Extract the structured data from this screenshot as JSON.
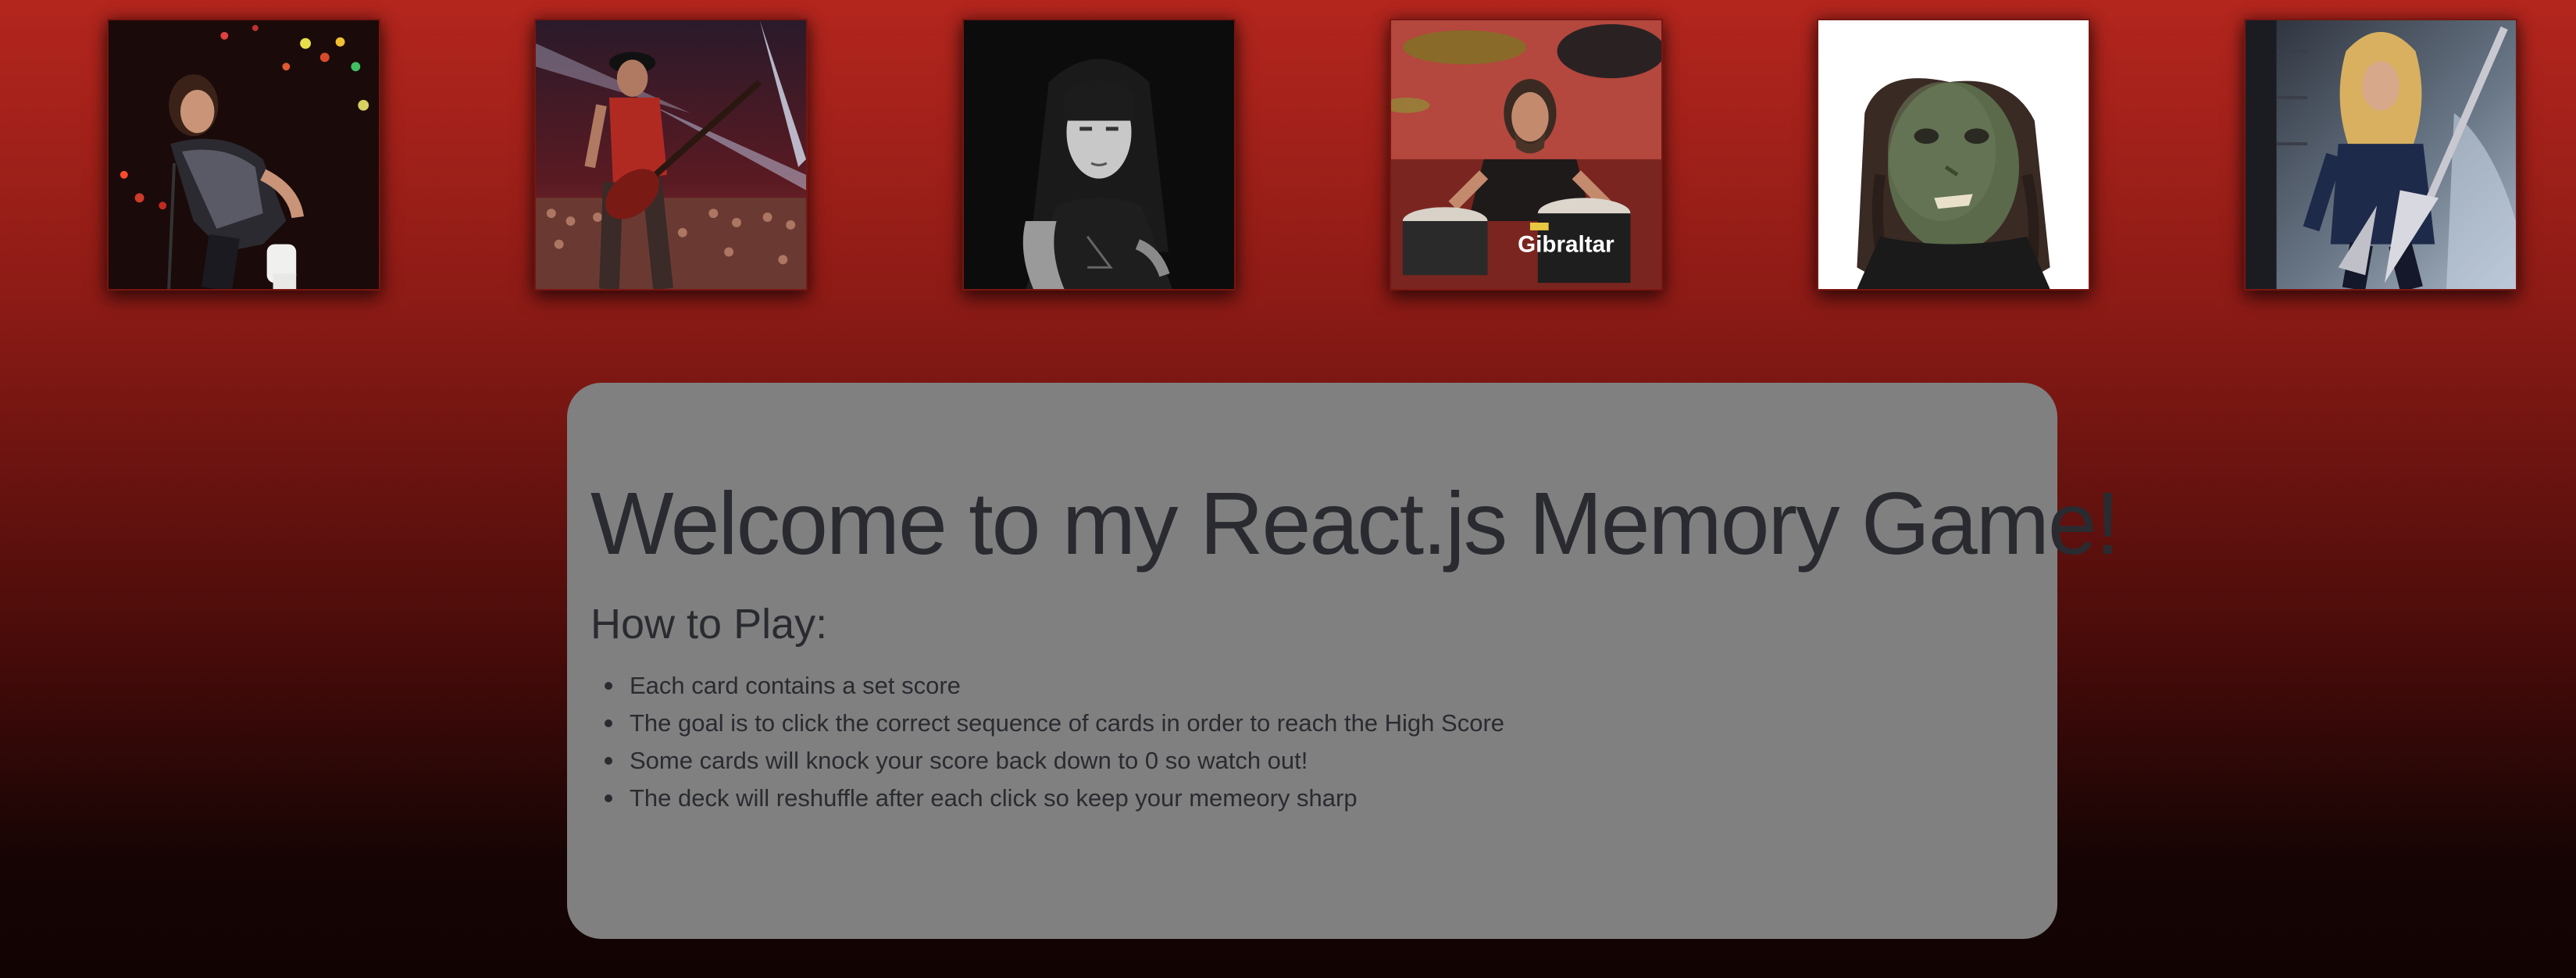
{
  "cards": [
    {
      "name": "card-singer-stage",
      "alt": "Metal singer performing on stage"
    },
    {
      "name": "card-bassist-stage",
      "alt": "Bassist playing to a large crowd"
    },
    {
      "name": "card-guitarist-portrait",
      "alt": "Black and white portrait of a guitarist"
    },
    {
      "name": "card-drummer",
      "alt": "Drummer behind a drum kit",
      "kit_text": "Gibraltar"
    },
    {
      "name": "card-masked-musician",
      "alt": "Musician wearing a mask"
    },
    {
      "name": "card-guitarist-flying-v",
      "alt": "Guitarist with a V-shaped guitar"
    }
  ],
  "welcome": {
    "title": "Welcome to my React.js Memory Game!",
    "subtitle": "How to Play:",
    "rules": [
      "Each card contains a set score",
      "The goal is to click the correct sequence of cards in order to reach the High Score",
      "Some cards will knock your score back down to 0 so watch out!",
      "The deck will reshuffle after each click so keep your memeory sharp"
    ]
  },
  "colors": {
    "background_top": "#b3261e",
    "background_bottom": "#120303",
    "panel": "#808080",
    "text": "#2a2b30"
  }
}
